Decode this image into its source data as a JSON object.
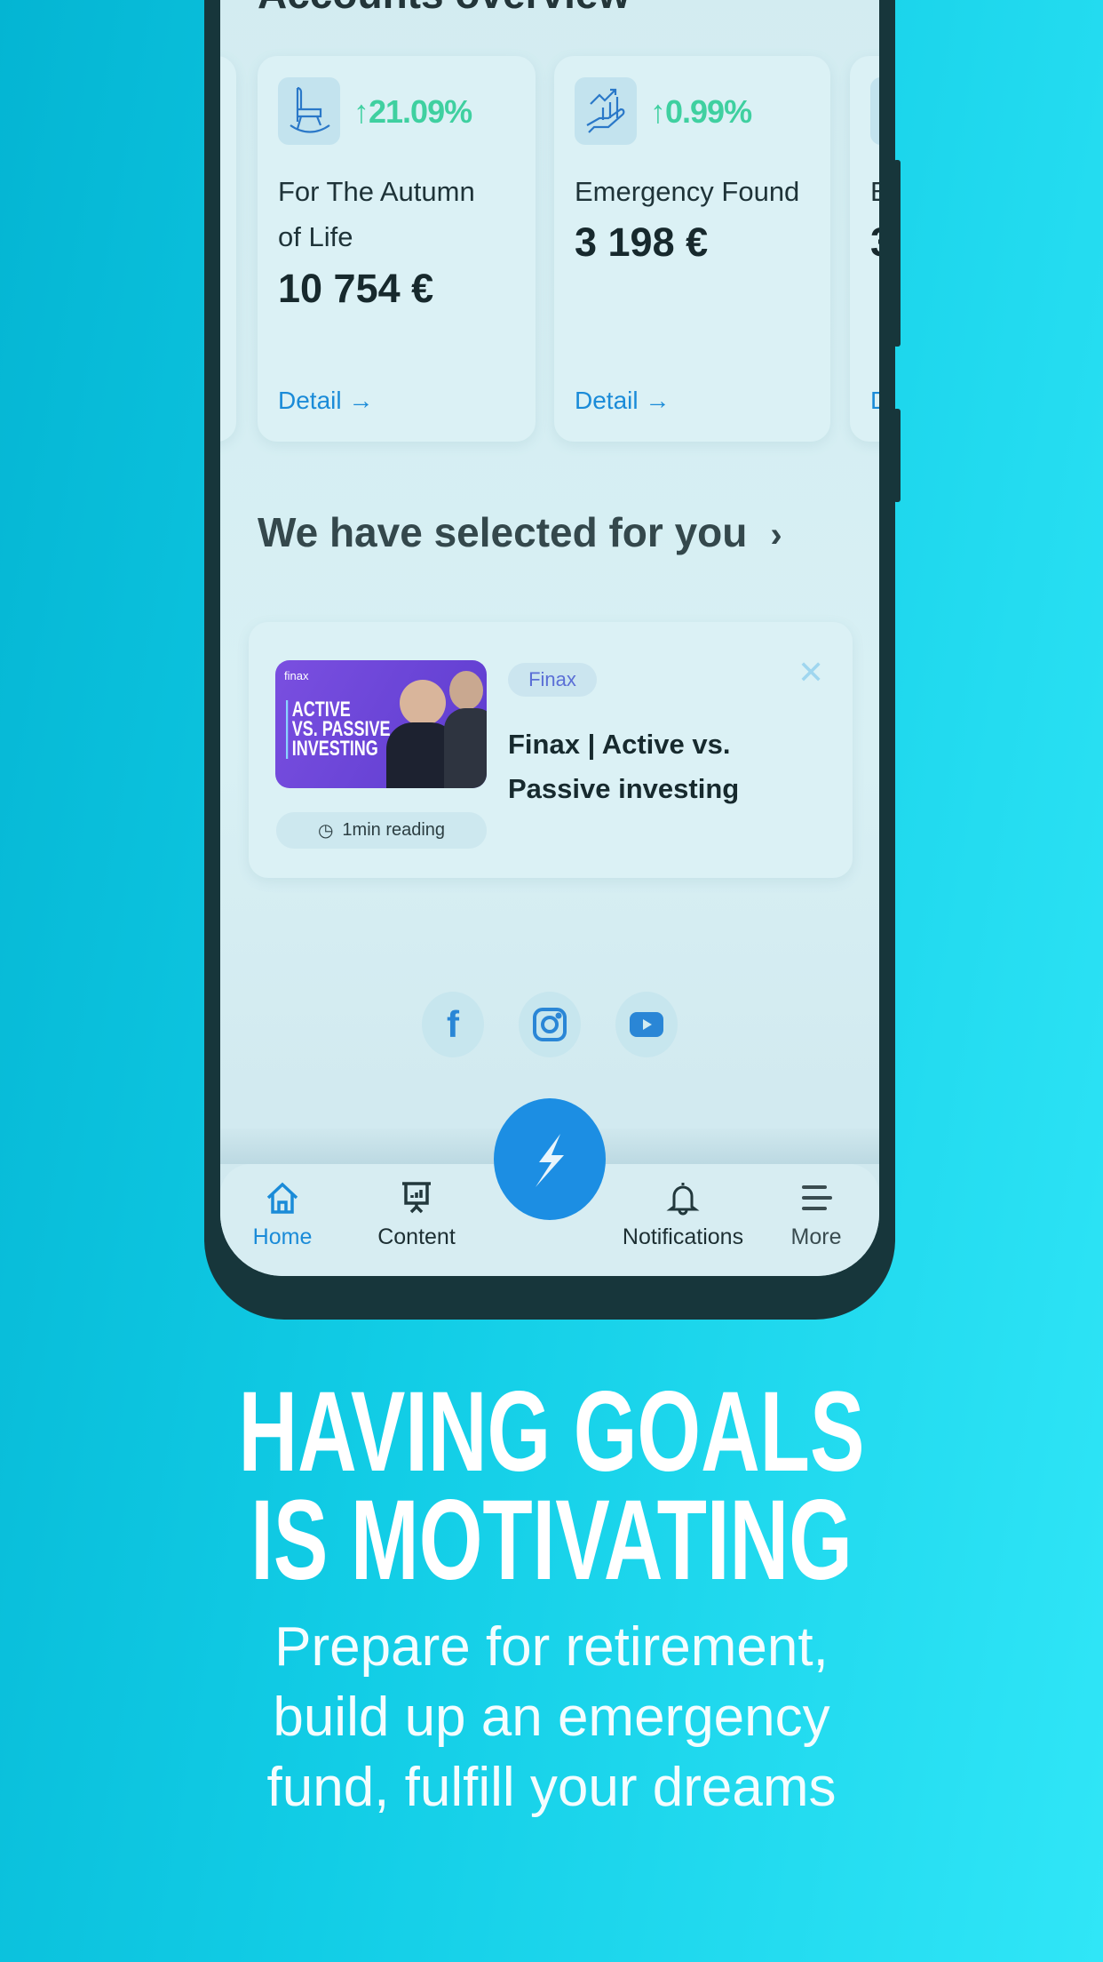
{
  "section_title": "Accounts overview",
  "accounts": [
    {
      "icon": "rocking-chair-icon",
      "change": "21.09%",
      "name_line1": "For The Autumn",
      "name_line2": "of Life",
      "amount": "10 754 €",
      "detail": "Detail"
    },
    {
      "icon": "growth-hand-icon",
      "change": "0.99%",
      "name_line1": "Emergency Found",
      "amount": "3 198 €",
      "detail": "Detail"
    },
    {
      "name_line1": "E",
      "amount": "3",
      "detail": "D"
    }
  ],
  "selected": {
    "title": "We have selected for you",
    "article": {
      "thumb_brand": "finax",
      "thumb_text": [
        "ACTIVE",
        "VS. PASSIVE",
        "INVESTING"
      ],
      "tag": "Finax",
      "title_line1": "Finax | Active vs.",
      "title_line2": "Passive investing",
      "reading": "1min reading"
    }
  },
  "social": [
    "facebook-icon",
    "instagram-icon",
    "youtube-icon"
  ],
  "nav": {
    "home": "Home",
    "content": "Content",
    "notifications": "Notifications",
    "more": "More"
  },
  "headline": [
    "HAVING GOALS",
    "IS MOTIVATING"
  ],
  "subtitle": [
    "Prepare for retirement,",
    "build up an emergency",
    "fund, fulfill your dreams"
  ],
  "colors": {
    "accent": "#1a8bd8",
    "positive": "#3fd0a0",
    "background": "#12cde6"
  }
}
